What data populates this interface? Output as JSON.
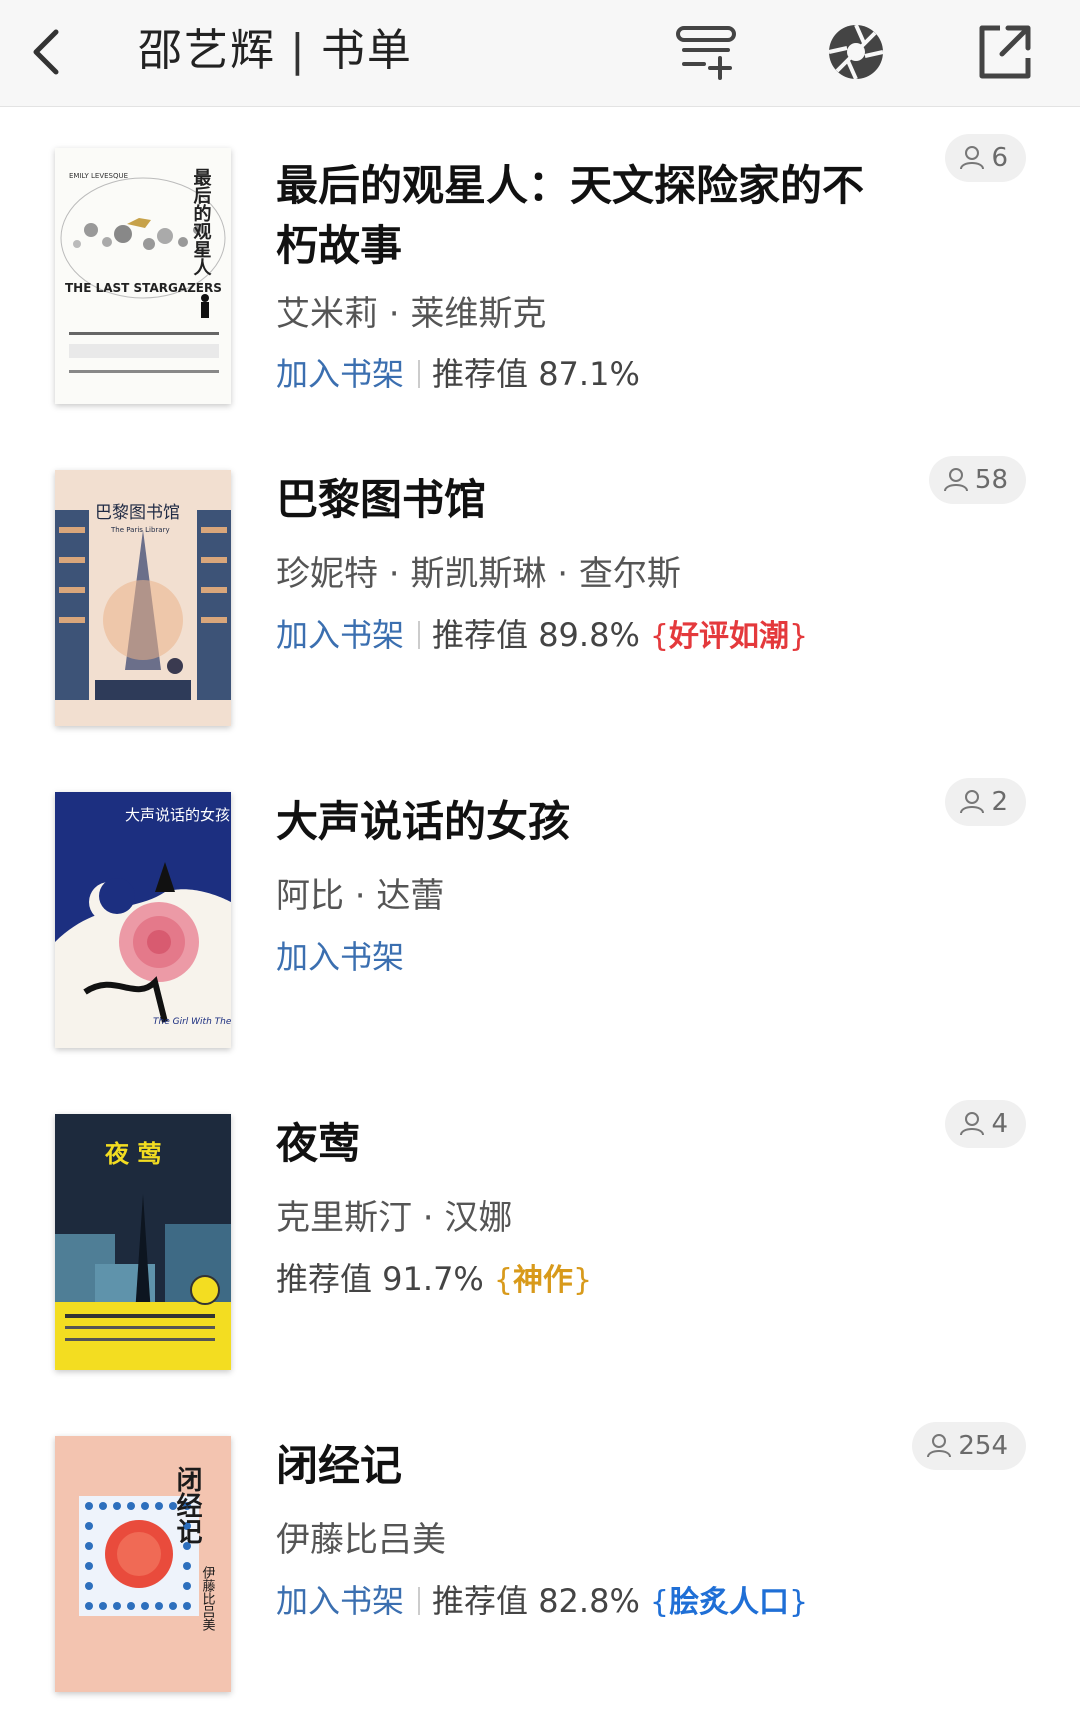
{
  "header": {
    "title_name": "邵艺辉",
    "title_separator": "|",
    "title_suffix": "书单"
  },
  "books": [
    {
      "title": "最后的观星人：天文探险家的不朽故事",
      "author": "艾米莉 · 莱维斯克",
      "add_label": "加入书架",
      "rec_label": "推荐值 87.1%",
      "badge": "",
      "reader_count": "6",
      "cover_text": "最后的观星人",
      "cover_en": "THE LAST STARGAZERS",
      "cover_author": "EMILY LEVESQUE"
    },
    {
      "title": "巴黎图书馆",
      "author": "珍妮特 · 斯凯斯琳 · 查尔斯",
      "add_label": "加入书架",
      "rec_label": "推荐值 89.8%",
      "badge": "好评如潮",
      "badge_color": "#e4393c",
      "reader_count": "58",
      "cover_text": "巴黎图书馆",
      "cover_en": "The Paris Library"
    },
    {
      "title": "大声说话的女孩",
      "author": "阿比 · 达蕾",
      "add_label": "加入书架",
      "rec_label": "",
      "badge": "",
      "reader_count": "2",
      "cover_text": "大声说话的女孩",
      "cover_en": "The Girl With The Louding Voice"
    },
    {
      "title": "夜莺",
      "author": "克里斯汀 · 汉娜",
      "add_label": "",
      "rec_label": "推荐值 91.7%",
      "badge": "神作",
      "badge_color": "#d89a1b",
      "reader_count": "4",
      "cover_text": "夜 莺"
    },
    {
      "title": "闭经记",
      "author": "伊藤比吕美",
      "add_label": "加入书架",
      "rec_label": "推荐值 82.8%",
      "badge": "脍炙人口",
      "badge_color": "#1f6fd6",
      "reader_count": "254",
      "cover_text": "闭经记",
      "cover_author": "伊藤比吕美"
    }
  ],
  "colors": {
    "link": "#3b6fb0",
    "header_bg": "#f7f7f7",
    "count_bg": "#f0f0f0"
  },
  "icons": [
    "back-arrow-icon",
    "add-to-list-icon",
    "camera-aperture-icon",
    "share-icon",
    "person-icon"
  ]
}
